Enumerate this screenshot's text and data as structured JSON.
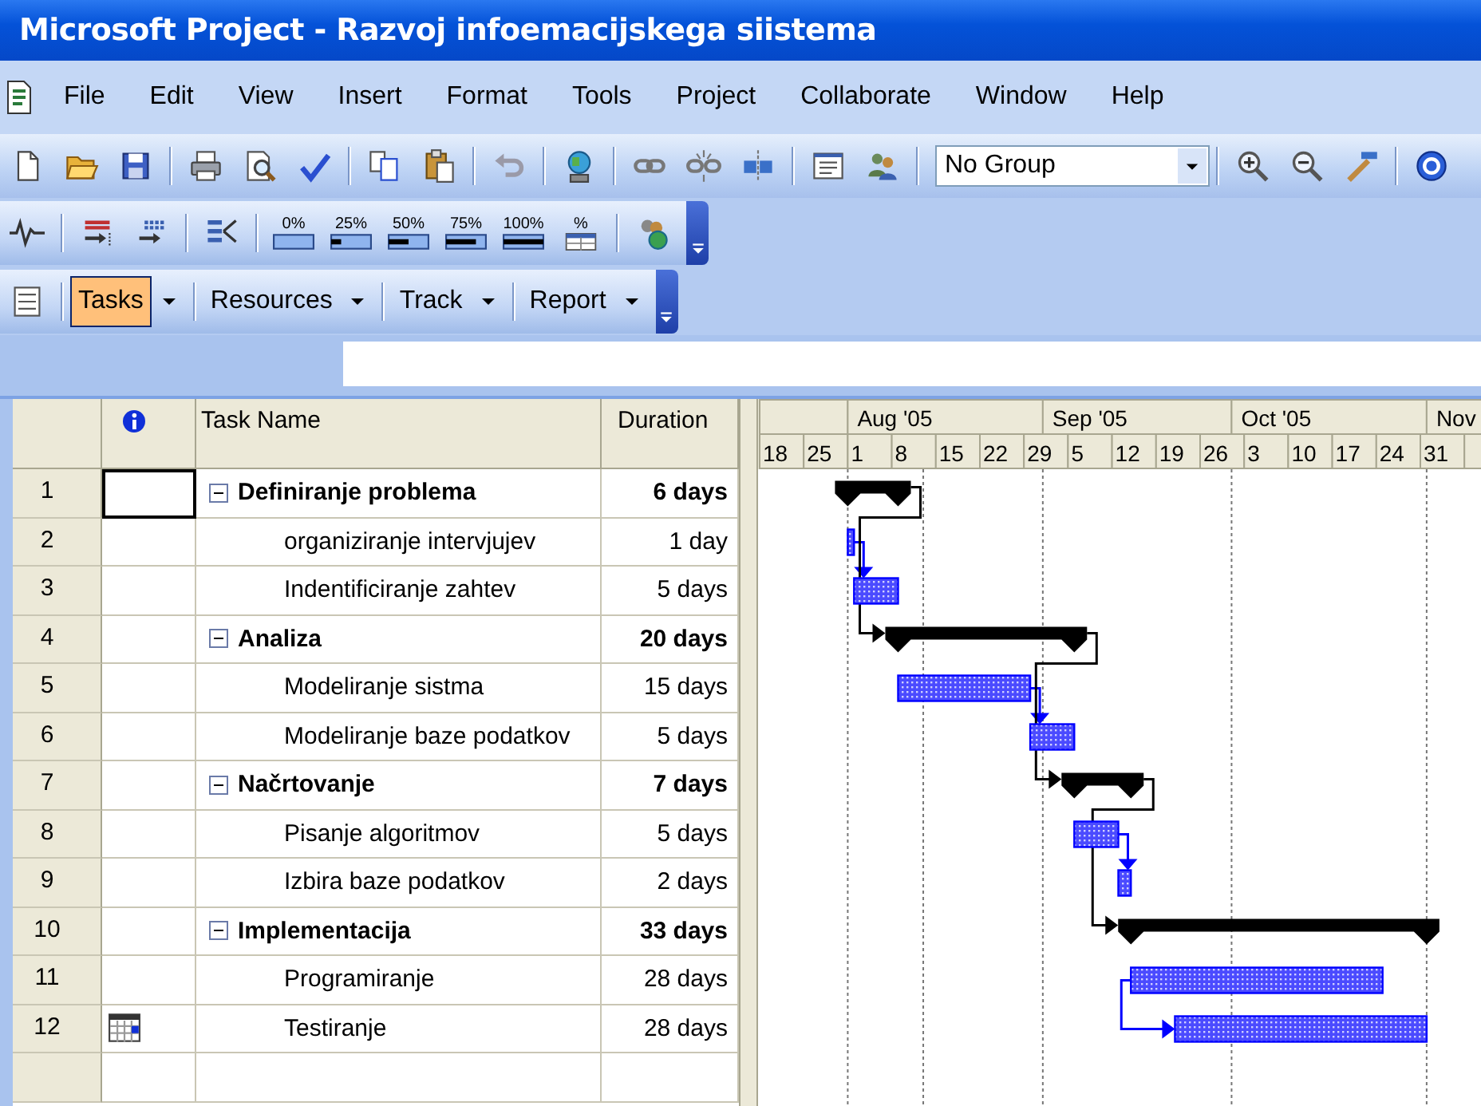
{
  "window": {
    "title": "Microsoft Project - Razvoj infoemacijskega siistema"
  },
  "menu": [
    "File",
    "Edit",
    "View",
    "Insert",
    "Format",
    "Tools",
    "Project",
    "Collaborate",
    "Window",
    "Help"
  ],
  "standard_toolbar": {
    "group_field": "No Group"
  },
  "tracking_toolbar": {
    "percent_buttons": [
      "0%",
      "25%",
      "50%",
      "75%",
      "100%"
    ],
    "update_button": "%"
  },
  "guide_toolbar": {
    "tabs": [
      {
        "label": "Tasks",
        "selected": true
      },
      {
        "label": "Resources",
        "selected": false
      },
      {
        "label": "Track",
        "selected": false
      },
      {
        "label": "Report",
        "selected": false
      }
    ]
  },
  "table": {
    "columns": [
      "Task Name",
      "Duration"
    ]
  },
  "tasks": [
    {
      "id": "1",
      "name": "Definiranje problema",
      "duration": "6 days",
      "kind": "summary",
      "selected": true,
      "expanded": true,
      "children": [
        {
          "id": "2",
          "name": "organiziranje intervjujev",
          "duration": "1 day",
          "kind": "task",
          "selected": false
        },
        {
          "id": "3",
          "name": "Indentificiranje zahtev",
          "duration": "5 days",
          "kind": "task",
          "selected": false
        }
      ]
    },
    {
      "id": "4",
      "name": "Analiza",
      "duration": "20 days",
      "kind": "summary",
      "selected": false,
      "expanded": true,
      "children": [
        {
          "id": "5",
          "name": "Modeliranje sistma",
          "duration": "15 days",
          "kind": "task",
          "selected": false
        },
        {
          "id": "6",
          "name": "Modeliranje baze podatkov",
          "duration": "5 days",
          "kind": "task",
          "selected": false
        }
      ]
    },
    {
      "id": "7",
      "name": "Načrtovanje",
      "duration": "7 days",
      "kind": "summary",
      "selected": false,
      "expanded": true,
      "children": [
        {
          "id": "8",
          "name": "Pisanje algoritmov",
          "duration": "5 days",
          "kind": "task",
          "selected": false
        },
        {
          "id": "9",
          "name": "Izbira baze podatkov",
          "duration": "2 days",
          "kind": "task",
          "selected": false
        }
      ]
    },
    {
      "id": "10",
      "name": "Implementacija",
      "duration": "33 days",
      "kind": "summary",
      "selected": false,
      "expanded": true,
      "children": [
        {
          "id": "11",
          "name": "Programiranje",
          "duration": "28 days",
          "kind": "task",
          "selected": false
        },
        {
          "id": "12",
          "name": "Testiranje",
          "duration": "28 days",
          "kind": "constrained",
          "selected": false
        }
      ]
    }
  ],
  "gantt": {
    "months": [
      "Aug '05",
      "Sep '05",
      "Oct '05",
      "Nov"
    ],
    "weeks": [
      "18",
      "25",
      "1",
      "8",
      "15",
      "22",
      "29",
      "5",
      "12",
      "19",
      "26",
      "3",
      "10",
      "17",
      "24",
      "31"
    ]
  }
}
